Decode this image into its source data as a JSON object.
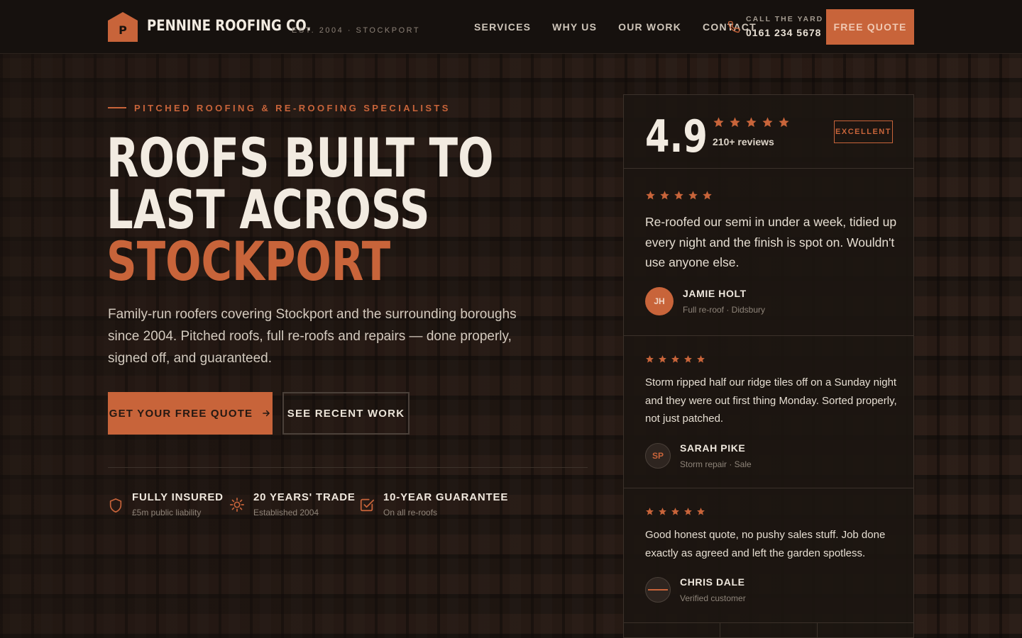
{
  "header": {
    "logo_letter": "P",
    "brand_name": "PENNINE ROOFING CO.",
    "brand_sub": "EST. 2004 · STOCKPORT",
    "nav": [
      "SERVICES",
      "WHY US",
      "OUR WORK",
      "CONTACT"
    ],
    "call_label": "CALL THE YARD",
    "call_number": "0161 234 5678",
    "quote_button": "FREE QUOTE"
  },
  "hero": {
    "eyebrow": "PITCHED ROOFING & RE-ROOFING SPECIALISTS",
    "headline_line1": "ROOFS BUILT TO",
    "headline_line2": "LAST ACROSS",
    "headline_accent": "STOCKPORT",
    "lede": "Family-run roofers covering Stockport and the surrounding boroughs since 2004. Pitched roofs, full re-roofs and repairs — done properly, signed off, and guaranteed.",
    "primary_cta": "GET YOUR FREE QUOTE",
    "secondary_cta": "SEE RECENT WORK",
    "badges": [
      {
        "title": "FULLY INSURED",
        "sub": "£5m public liability",
        "icon": "shield-icon"
      },
      {
        "title": "20 YEARS' TRADE",
        "sub": "Established 2004",
        "icon": "sun-icon"
      },
      {
        "title": "10-YEAR GUARANTEE",
        "sub": "On all re-roofs",
        "icon": "check-square-icon"
      }
    ]
  },
  "reviews": {
    "rating": "4.9",
    "stars": 5,
    "count": "210+ reviews",
    "badge": "EXCELLENT",
    "items": [
      {
        "text": "Re-roofed our semi in under a week, tidied up every night and the finish is spot on. Wouldn't use anyone else.",
        "initials": "JH",
        "name": "JAMIE HOLT",
        "sub": "Full re-roof · Didsbury",
        "stars": 5
      },
      {
        "text": "Storm ripped half our ridge tiles off on a Sunday night and they were out first thing Monday. Sorted properly, not just patched.",
        "initials": "SP",
        "name": "SARAH PIKE",
        "sub": "Storm repair · Sale",
        "stars": 5
      },
      {
        "text": "Good honest quote, no pushy sales stuff. Job done exactly as agreed and left the garden spotless.",
        "initials": "",
        "name": "CHRIS DALE",
        "sub": "Verified customer",
        "stars": 5
      }
    ]
  },
  "colors": {
    "accent": "#c8643a",
    "header_bg": "#16110e",
    "text": "#efe8de"
  }
}
